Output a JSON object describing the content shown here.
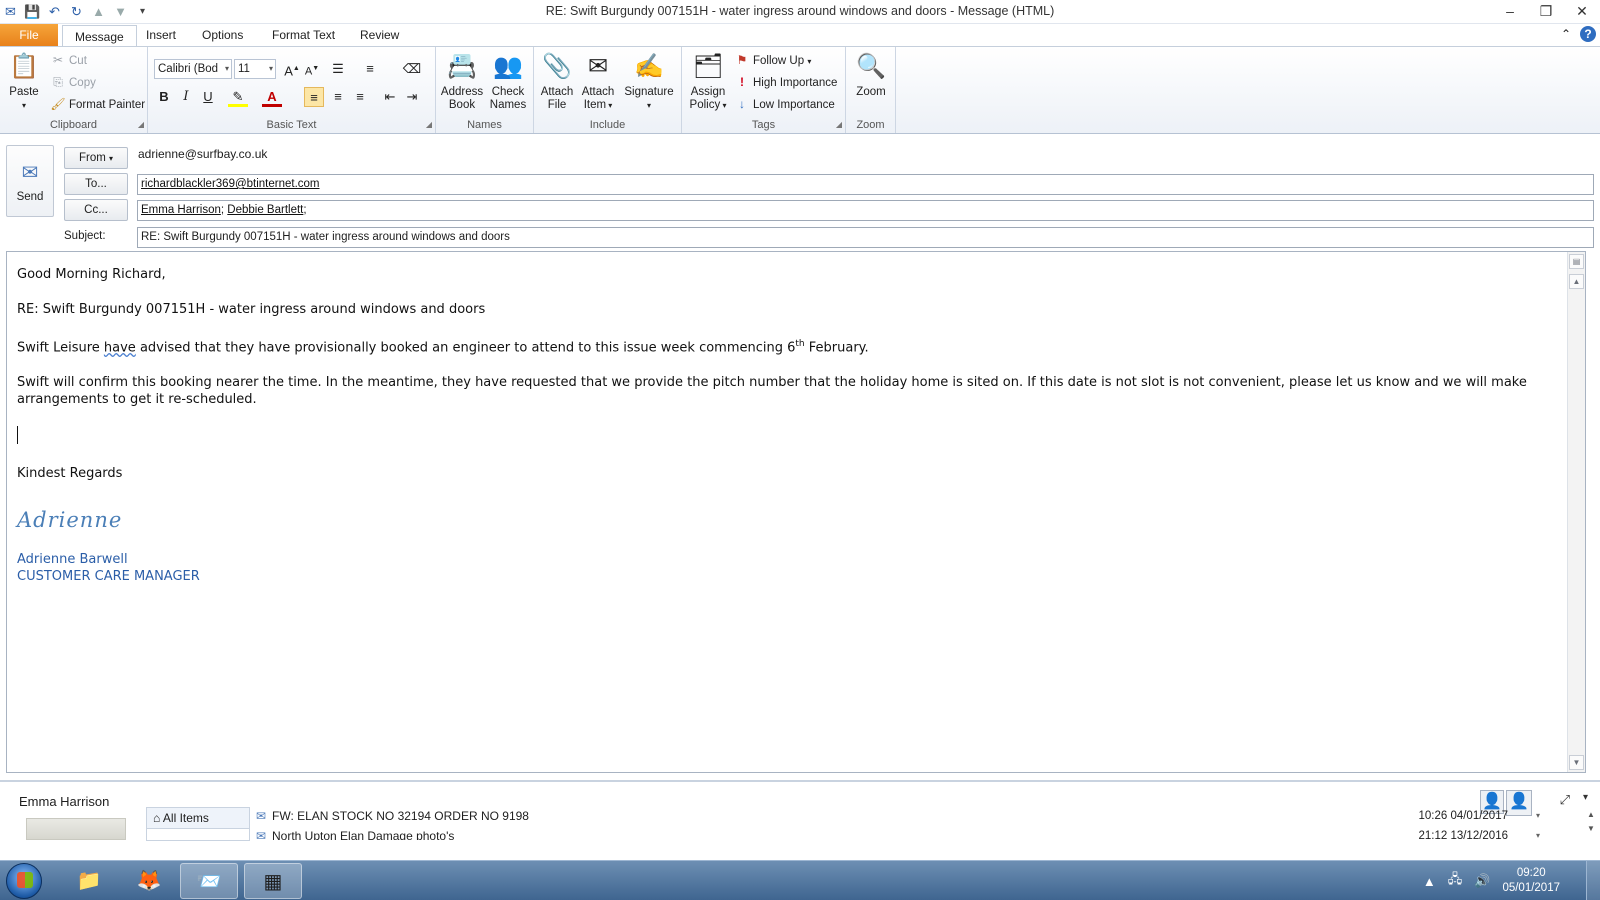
{
  "window": {
    "title": "RE: Swift Burgundy 007151H - water ingress around windows and doors  -  Message (HTML)",
    "controls": [
      "minimize",
      "restore",
      "close"
    ]
  },
  "ribbon_tabs": [
    "File",
    "Message",
    "Insert",
    "Options",
    "Format Text",
    "Review"
  ],
  "active_tab": "Message",
  "ribbon": {
    "clipboard": {
      "label": "Clipboard",
      "paste": "Paste",
      "cut": "Cut",
      "copy": "Copy",
      "format_painter": "Format Painter"
    },
    "basic_text": {
      "label": "Basic Text",
      "font": "Calibri (Body)",
      "font_display": "Calibri (Bod",
      "size": "11",
      "bold": "B",
      "italic": "I",
      "underline": "U"
    },
    "names": {
      "label": "Names",
      "address_book": [
        "Address",
        "Book"
      ],
      "check_names": [
        "Check",
        "Names"
      ]
    },
    "include": {
      "label": "Include",
      "attach_file": [
        "Attach",
        "File"
      ],
      "attach_item": [
        "Attach",
        "Item"
      ],
      "signature": "Signature"
    },
    "tags": {
      "label": "Tags",
      "assign_policy": [
        "Assign",
        "Policy"
      ],
      "follow_up": "Follow Up",
      "high_importance": "High Importance",
      "low_importance": "Low Importance"
    },
    "zoom": {
      "label": "Zoom",
      "zoom": "Zoom"
    }
  },
  "compose": {
    "send": "Send",
    "from_label": "From",
    "from_value": "adrienne@surfbay.co.uk",
    "to_label": "To...",
    "to_value": "richardblackler369@btinternet.com",
    "cc_label": "Cc...",
    "cc_values": [
      "Emma Harrison",
      "Debbie Bartlett"
    ],
    "subject_label": "Subject:",
    "subject_value": "RE: Swift Burgundy 007151H - water ingress around windows and doors"
  },
  "body": {
    "greeting": "Good Morning Richard,",
    "re_line": "RE: Swift Burgundy 007151H - water ingress around windows and doors",
    "para1_pre": "Swift Leisure ",
    "para1_flagged": "have",
    "para1_mid": " advised that they have provisionally booked an engineer to attend to this issue week commencing 6",
    "para1_sup": "th",
    "para1_post": " February.",
    "para2": "Swift will confirm this booking nearer the time.  In the meantime, they have requested that we provide the pitch number that the holiday home is sited on.  If this date is not slot is not convenient, please let us know and we will make arrangements to get it re-scheduled.",
    "closing": "Kindest Regards",
    "signature_script": "Adrienne",
    "sig_name": "Adrienne Barwell",
    "sig_title": "CUSTOMER CARE MANAGER"
  },
  "people_pane": {
    "contact_name": "Emma Harrison",
    "all_items": "All Items",
    "items": [
      {
        "subject": "FW: ELAN STOCK NO 32194 ORDER NO 9198",
        "when": "10:26  04/01/2017"
      },
      {
        "subject": "North Upton Elan Damage photo's",
        "when": "21:12  13/12/2016"
      }
    ]
  },
  "taskbar": {
    "apps": [
      "start",
      "explorer",
      "firefox",
      "outlook",
      "app"
    ],
    "time": "09:20",
    "date": "05/01/2017"
  },
  "colors": {
    "file_tab": "#e8811b",
    "signature": "#2b5ea8",
    "taskbar": "#3f6590"
  }
}
